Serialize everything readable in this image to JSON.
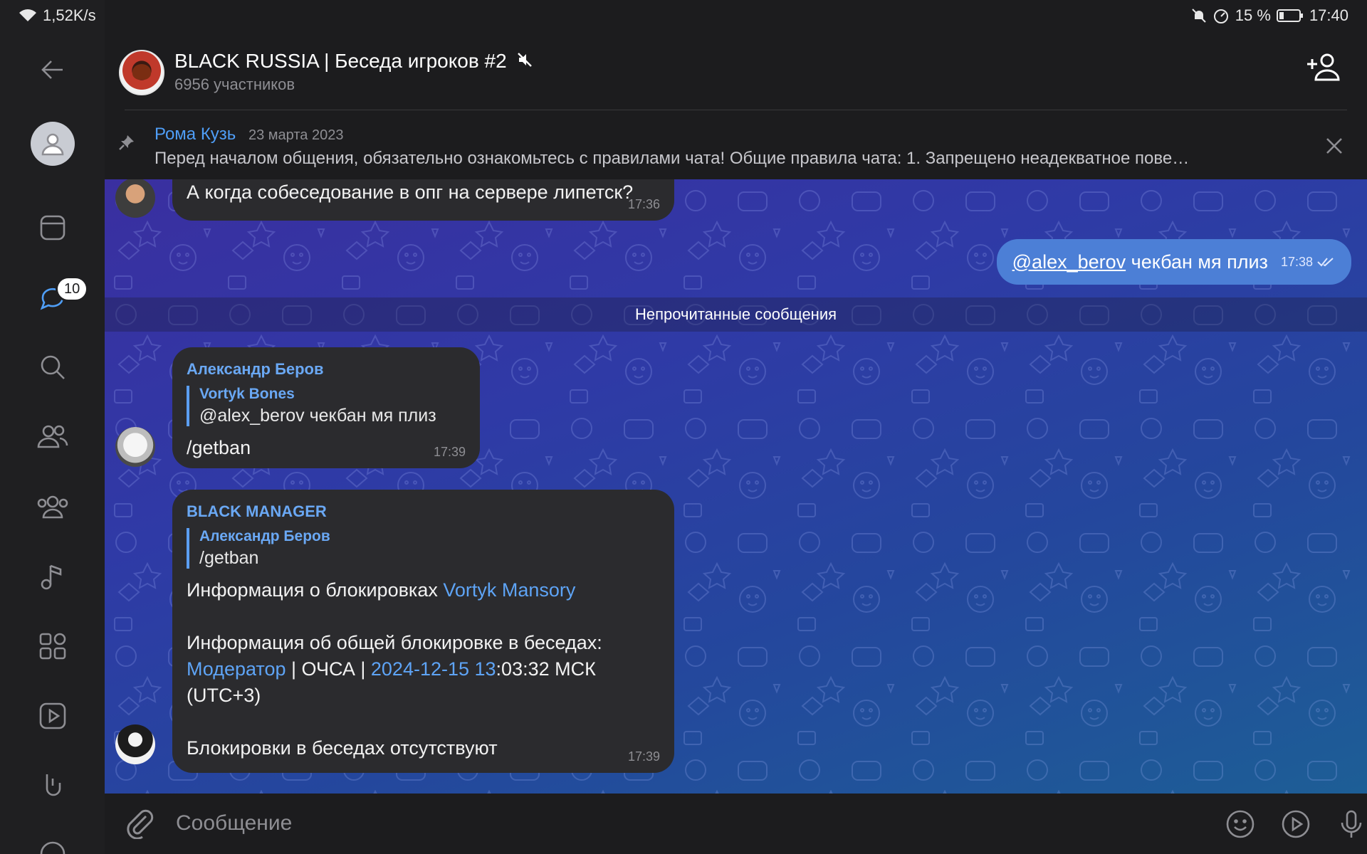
{
  "status_bar": {
    "net_speed": "1,52K/s",
    "battery": "15 %",
    "time": "17:40"
  },
  "rail": {
    "chats_badge": "10",
    "icons": [
      "back-arrow-icon",
      "profile-avatar",
      "calendar-icon",
      "chats-icon",
      "search-icon",
      "contacts-icon",
      "groups-icon",
      "music-icon",
      "apps-icon",
      "video-icon",
      "gesture-icon",
      "emoji-icon"
    ]
  },
  "header": {
    "title": "BLACK RUSSIA | Беседа игроков #2",
    "subtitle": "6956 участников"
  },
  "pinned": {
    "author": "Рома Кузь",
    "date": "23 марта 2023",
    "text": "Перед началом общения, обязательно ознакомьтесь с правилами чата!   Общие правила чата:   1. Запрещено неадекватное пове…"
  },
  "messages": {
    "m1": {
      "text": "А когда собеседование в опг на сервере липетск?",
      "time": "17:36"
    },
    "m2": {
      "mention": "@alex_berov",
      "text": "чекбан мя плиз",
      "time": "17:38"
    },
    "unread_label": "Непрочитанные сообщения",
    "m3": {
      "sender": "Александр Беров",
      "reply_name": "Vortyk Bones",
      "reply_text": "@alex_berov чекбан мя плиз",
      "text": "/getban",
      "time": "17:39"
    },
    "m4": {
      "sender": "BLACK MANAGER",
      "reply_name": "Александр Беров",
      "reply_text": "/getban",
      "line1_prefix": "Информация о блокировках ",
      "line1_link": "Vortyk Mansory",
      "line2": "Информация об общей блокировке в беседах:",
      "line3_link1": "Модератор",
      "line3_mid": " | ОЧСА | ",
      "line3_link2": "2024-12-15 13",
      "line3_suffix": ":03:32 МСК",
      "line4": "(UTC+3)",
      "line5": "Блокировки в беседах отсутствуют",
      "time": "17:39"
    }
  },
  "composer": {
    "placeholder": "Сообщение"
  },
  "colors": {
    "accent": "#4f9ef7",
    "outgoing_bubble": "#4c7fd6",
    "incoming_bubble": "#2b2b2e"
  }
}
